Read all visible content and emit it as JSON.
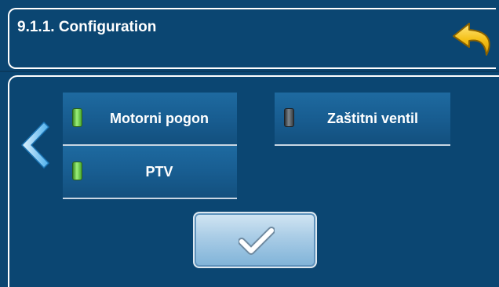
{
  "header": {
    "title": "9.1.1. Configuration",
    "back_icon": "return-arrow-icon"
  },
  "nav": {
    "prev_icon": "chevron-left-icon"
  },
  "options": [
    {
      "label": "Motorni pogon",
      "state": "on"
    },
    {
      "label": "PTV",
      "state": "on"
    },
    {
      "label": "Zaštitni ventil",
      "state": "off"
    }
  ],
  "confirm": {
    "icon": "checkmark-icon"
  },
  "colors": {
    "background": "#0b4672",
    "button": "#185d91",
    "led_on": "#7ad35a",
    "led_off": "#5c6369",
    "arrow_yellow": "#f2c21b"
  }
}
